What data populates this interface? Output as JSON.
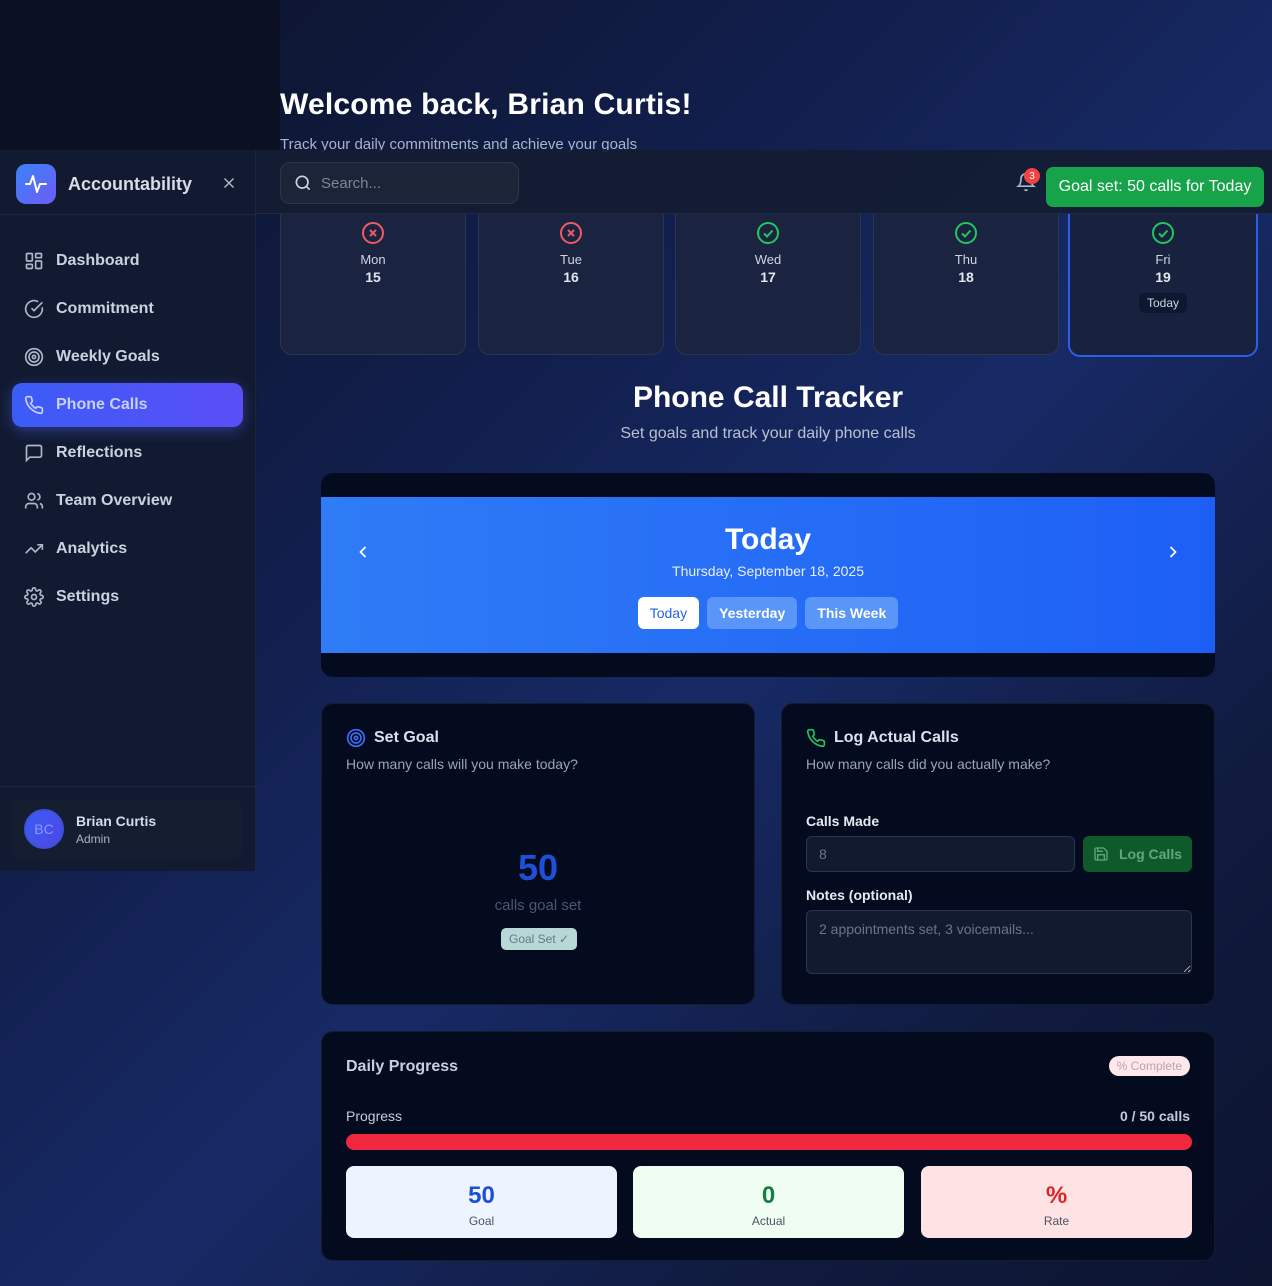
{
  "welcome": {
    "title": "Welcome back, Brian Curtis!",
    "subtitle": "Track your daily commitments and achieve your goals"
  },
  "header": {
    "search_placeholder": "Search...",
    "notification_count": "3",
    "toast": "Goal set: 50 calls for Today"
  },
  "sidebar": {
    "brand": "Accountability",
    "items": [
      {
        "label": "Dashboard",
        "icon": "dashboard-icon"
      },
      {
        "label": "Commitment",
        "icon": "check-circle-icon"
      },
      {
        "label": "Weekly Goals",
        "icon": "target-icon"
      },
      {
        "label": "Phone Calls",
        "icon": "phone-icon",
        "active": true
      },
      {
        "label": "Reflections",
        "icon": "message-icon"
      },
      {
        "label": "Team Overview",
        "icon": "users-icon"
      },
      {
        "label": "Analytics",
        "icon": "trending-up-icon"
      },
      {
        "label": "Settings",
        "icon": "gear-icon"
      }
    ],
    "user": {
      "initials": "BC",
      "name": "Brian Curtis",
      "role": "Admin"
    }
  },
  "days": [
    {
      "name": "Mon",
      "num": "15",
      "status": "missed"
    },
    {
      "name": "Tue",
      "num": "16",
      "status": "missed"
    },
    {
      "name": "Wed",
      "num": "17",
      "status": "done"
    },
    {
      "name": "Thu",
      "num": "18",
      "status": "done"
    },
    {
      "name": "Fri",
      "num": "19",
      "status": "done",
      "badge": "Today"
    }
  ],
  "tracker": {
    "title": "Phone Call Tracker",
    "subtitle": "Set goals and track your daily phone calls"
  },
  "date_nav": {
    "title": "Today",
    "date": "Thursday, September 18, 2025",
    "tabs": [
      "Today",
      "Yesterday",
      "This Week"
    ],
    "selected": "Today"
  },
  "set_goal": {
    "title": "Set Goal",
    "subtitle": "How many calls will you make today?",
    "value": "50",
    "value_label": "calls goal set",
    "badge": "Goal Set ✓"
  },
  "log_calls": {
    "title": "Log Actual Calls",
    "subtitle": "How many calls did you actually make?",
    "calls_label": "Calls Made",
    "calls_placeholder": "8",
    "button": "Log Calls",
    "notes_label": "Notes (optional)",
    "notes_placeholder": "2 appointments set, 3 voicemails..."
  },
  "progress": {
    "title": "Daily Progress",
    "badge": "% Complete",
    "label": "Progress",
    "count": "0 / 50 calls",
    "fraction": 0,
    "stats": [
      {
        "value": "50",
        "label": "Goal"
      },
      {
        "value": "0",
        "label": "Actual"
      },
      {
        "value": "%",
        "label": "Rate"
      }
    ]
  },
  "colors": {
    "accent": "#3b5cf6",
    "success": "#16a34a",
    "danger": "#ef4444",
    "date_band": "#2f7cf6"
  }
}
